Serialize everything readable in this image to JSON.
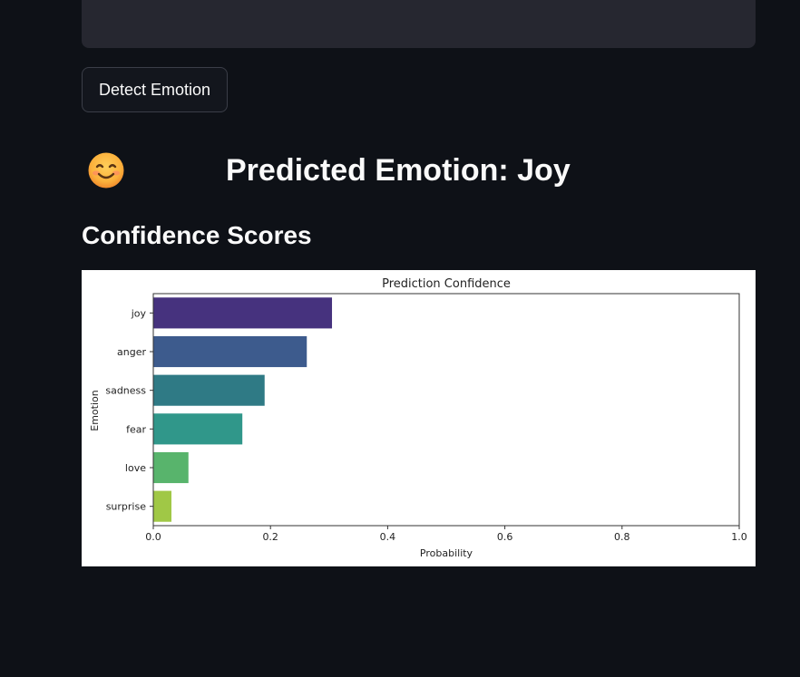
{
  "input": {
    "value": ""
  },
  "detect_button": {
    "label": "Detect Emotion"
  },
  "result": {
    "emoji_icon": "smiling-face-emoji",
    "predicted_text": "Predicted Emotion: Joy"
  },
  "confidence": {
    "heading": "Confidence Scores"
  },
  "chart_data": {
    "type": "bar",
    "orientation": "horizontal",
    "title": "Prediction Confidence",
    "xlabel": "Probability",
    "ylabel": "Emotion",
    "xlim": [
      0,
      1
    ],
    "xticks": [
      "0.0",
      "0.2",
      "0.4",
      "0.6",
      "0.8",
      "1.0"
    ],
    "categories": [
      "joy",
      "anger",
      "sadness",
      "fear",
      "love",
      "surprise"
    ],
    "values": [
      0.305,
      0.262,
      0.19,
      0.152,
      0.06,
      0.031
    ],
    "colors": [
      "#46327e",
      "#3d5b8d",
      "#2f7a85",
      "#30978a",
      "#58b46c",
      "#a0c846"
    ],
    "grid": false,
    "legend": false
  }
}
